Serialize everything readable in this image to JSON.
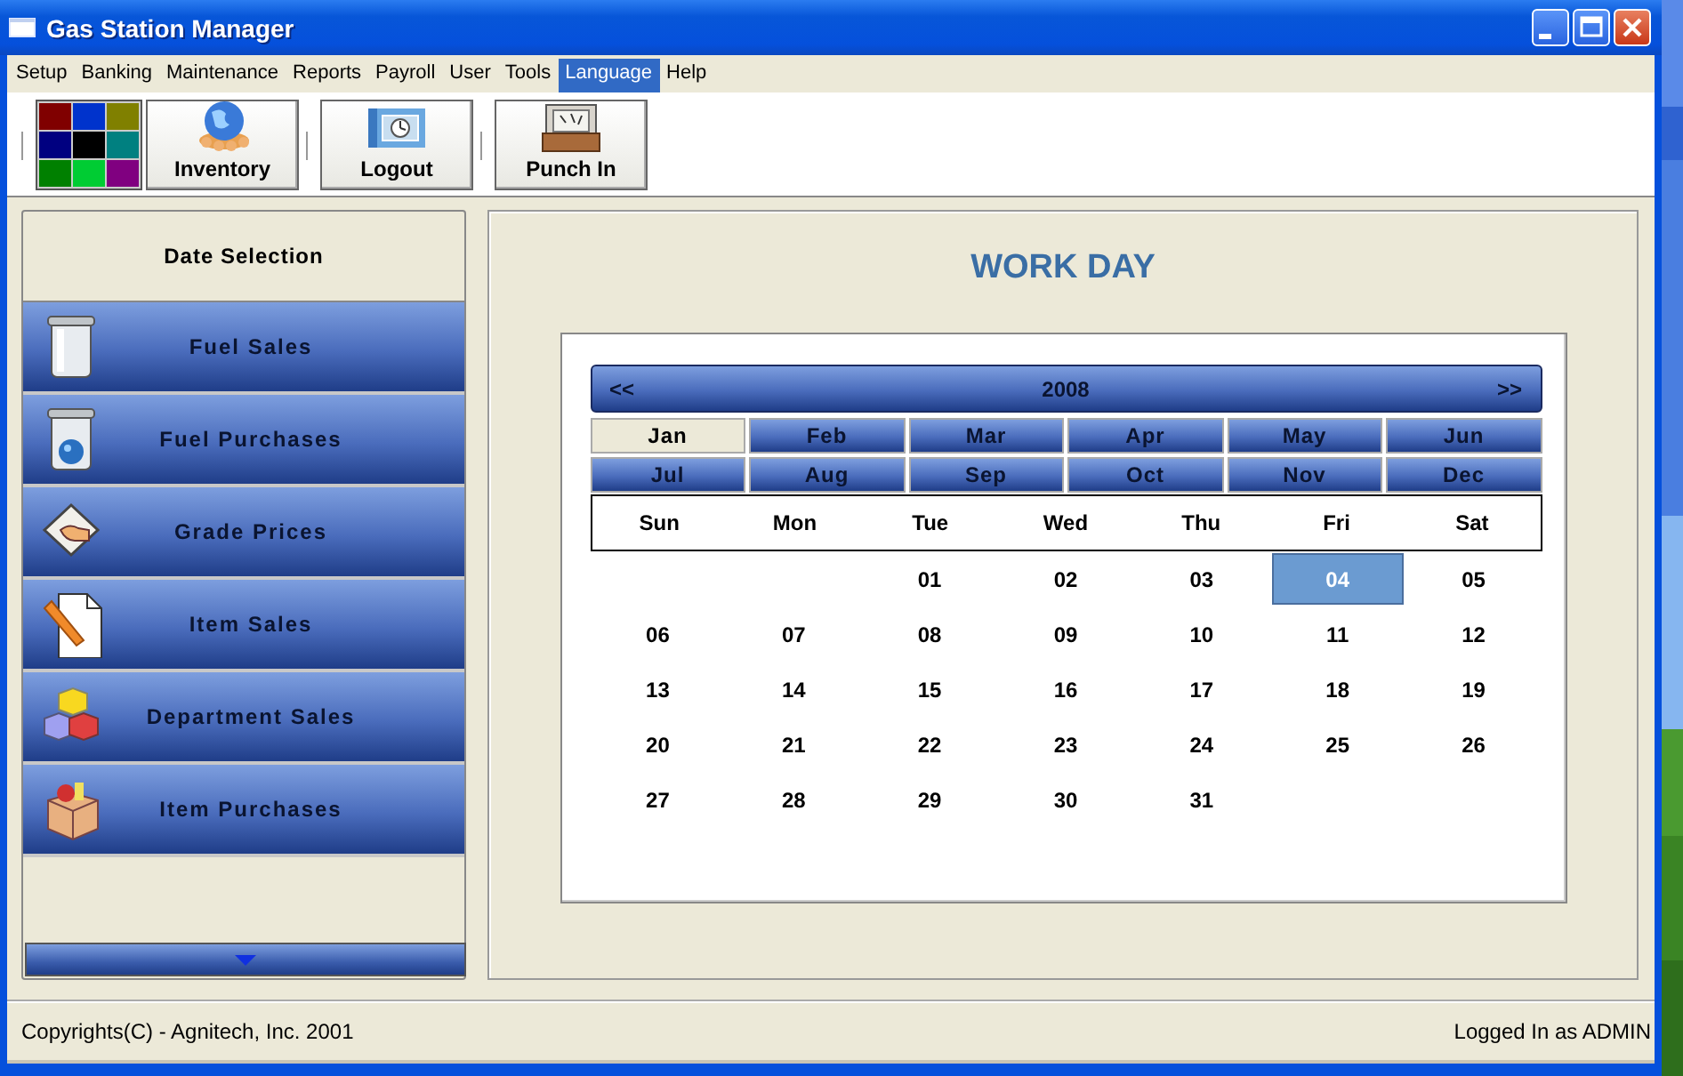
{
  "window": {
    "title": "Gas Station Manager"
  },
  "menu": [
    {
      "label": "Setup",
      "selected": false
    },
    {
      "label": "Banking",
      "selected": false
    },
    {
      "label": "Maintenance",
      "selected": false
    },
    {
      "label": "Reports",
      "selected": false
    },
    {
      "label": "Payroll",
      "selected": false
    },
    {
      "label": "User",
      "selected": false
    },
    {
      "label": "Tools",
      "selected": false
    },
    {
      "label": "Language",
      "selected": true
    },
    {
      "label": "Help",
      "selected": false
    }
  ],
  "toolbar": {
    "palette": [
      {
        "color": "#800000"
      },
      {
        "color": "#0033cc"
      },
      {
        "color": "#808000"
      },
      {
        "color": "#000080"
      },
      {
        "color": "#000000"
      },
      {
        "color": "#008080"
      },
      {
        "color": "#008000"
      },
      {
        "color": "#00cc33"
      },
      {
        "color": "#800080"
      }
    ],
    "buttons": [
      {
        "label": "Inventory"
      },
      {
        "label": "Logout"
      },
      {
        "label": "Punch In"
      }
    ]
  },
  "nav": {
    "header": "Date Selection",
    "items": [
      "Fuel Sales",
      "Fuel Purchases",
      "Grade Prices",
      "Item Sales",
      "Department Sales",
      "Item Purchases"
    ]
  },
  "calendar": {
    "title": "WORK DAY",
    "prev": "<<",
    "year": "2008",
    "next": ">>",
    "months": [
      {
        "label": "Jan",
        "selected": true
      },
      {
        "label": "Feb",
        "selected": false
      },
      {
        "label": "Mar",
        "selected": false
      },
      {
        "label": "Apr",
        "selected": false
      },
      {
        "label": "May",
        "selected": false
      },
      {
        "label": "Jun",
        "selected": false
      },
      {
        "label": "Jul",
        "selected": false
      },
      {
        "label": "Aug",
        "selected": false
      },
      {
        "label": "Sep",
        "selected": false
      },
      {
        "label": "Oct",
        "selected": false
      },
      {
        "label": "Nov",
        "selected": false
      },
      {
        "label": "Dec",
        "selected": false
      }
    ],
    "weekdays": [
      "Sun",
      "Mon",
      "Tue",
      "Wed",
      "Thu",
      "Fri",
      "Sat"
    ],
    "weeks": [
      [
        {
          "label": "01",
          "selected": false
        },
        {
          "label": "02",
          "selected": false
        },
        {
          "label": "03",
          "selected": false
        },
        {
          "label": "04",
          "selected": true
        },
        {
          "label": "05",
          "selected": false
        }
      ],
      [
        {
          "label": "06",
          "selected": false
        },
        {
          "label": "07",
          "selected": false
        },
        {
          "label": "08",
          "selected": false
        },
        {
          "label": "09",
          "selected": false
        },
        {
          "label": "10",
          "selected": false
        },
        {
          "label": "11",
          "selected": false
        },
        {
          "label": "12",
          "selected": false
        }
      ],
      [
        {
          "label": "13",
          "selected": false
        },
        {
          "label": "14",
          "selected": false
        },
        {
          "label": "15",
          "selected": false
        },
        {
          "label": "16",
          "selected": false
        },
        {
          "label": "17",
          "selected": false
        },
        {
          "label": "18",
          "selected": false
        },
        {
          "label": "19",
          "selected": false
        }
      ],
      [
        {
          "label": "20",
          "selected": false
        },
        {
          "label": "21",
          "selected": false
        },
        {
          "label": "22",
          "selected": false
        },
        {
          "label": "23",
          "selected": false
        },
        {
          "label": "24",
          "selected": false
        },
        {
          "label": "25",
          "selected": false
        },
        {
          "label": "26",
          "selected": false
        }
      ],
      [
        {
          "label": "27",
          "selected": false
        },
        {
          "label": "28",
          "selected": false
        },
        {
          "label": "29",
          "selected": false
        },
        {
          "label": "30",
          "selected": false
        },
        {
          "label": "31",
          "selected": false
        }
      ]
    ]
  },
  "status_bar": {
    "left": "Copyrights(C) - Agnitech, Inc. 2001",
    "right": "Logged In as ADMIN"
  }
}
